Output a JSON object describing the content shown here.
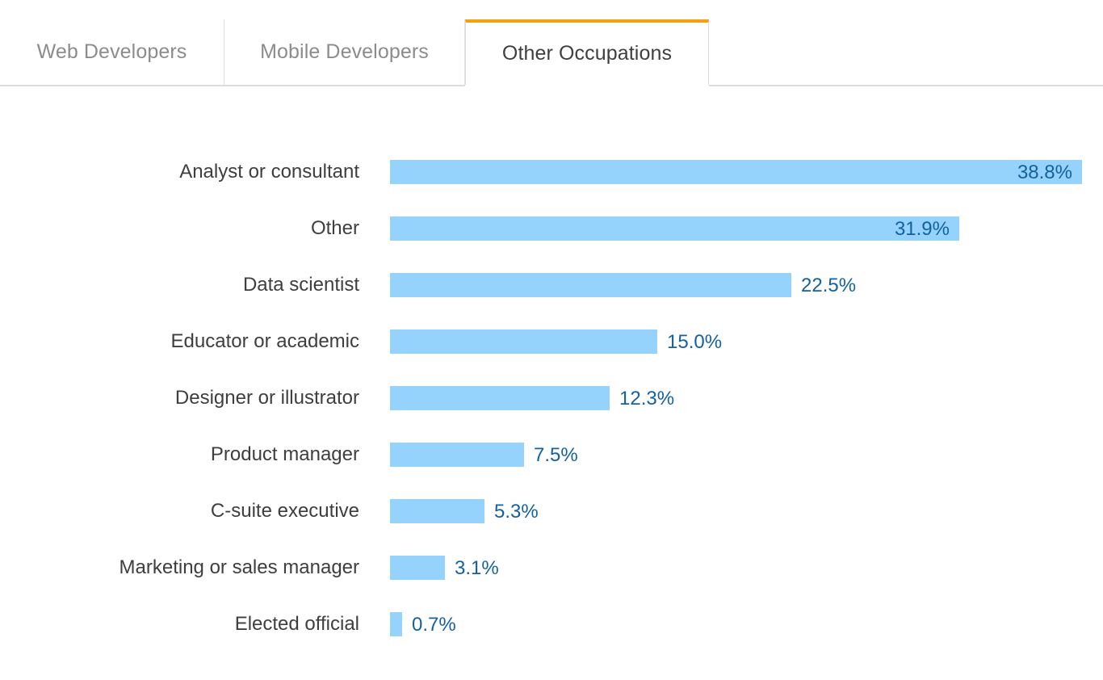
{
  "tabs": [
    {
      "label": "Web Developers",
      "active": false,
      "bordered": false
    },
    {
      "label": "Mobile Developers",
      "active": false,
      "bordered": true
    },
    {
      "label": "Other Occupations",
      "active": true,
      "bordered": false
    }
  ],
  "colors": {
    "bar": "#95d3fc",
    "value_text": "#13619f",
    "category_text": "#3e3e3e",
    "active_tab_accent": "#f5a011",
    "inactive_tab_text": "#8c8c8c",
    "active_tab_text": "#3f3f3f",
    "tab_border": "#dcdcdc"
  },
  "chart_data": {
    "type": "bar",
    "orientation": "horizontal",
    "title": "",
    "subtitle": "",
    "xlabel": "",
    "ylabel": "",
    "grid": false,
    "legend": null,
    "axis_visible": false,
    "tick_labels": [],
    "xlim": [
      0,
      38.8
    ],
    "value_suffix": "%",
    "categories": [
      "Analyst or consultant",
      "Other",
      "Data scientist",
      "Educator or academic",
      "Designer or illustrator",
      "Product manager",
      "C-suite executive",
      "Marketing or sales manager",
      "Elected official"
    ],
    "values": [
      38.8,
      31.9,
      22.5,
      15.0,
      12.3,
      7.5,
      5.3,
      3.1,
      0.7
    ],
    "data_labels": [
      "38.8%",
      "31.9%",
      "22.5%",
      "15.0%",
      "12.3%",
      "7.5%",
      "5.3%",
      "3.1%",
      "0.7%"
    ],
    "label_placement": [
      "inside",
      "inside",
      "outside",
      "outside",
      "outside",
      "outside",
      "outside",
      "outside",
      "outside"
    ]
  }
}
